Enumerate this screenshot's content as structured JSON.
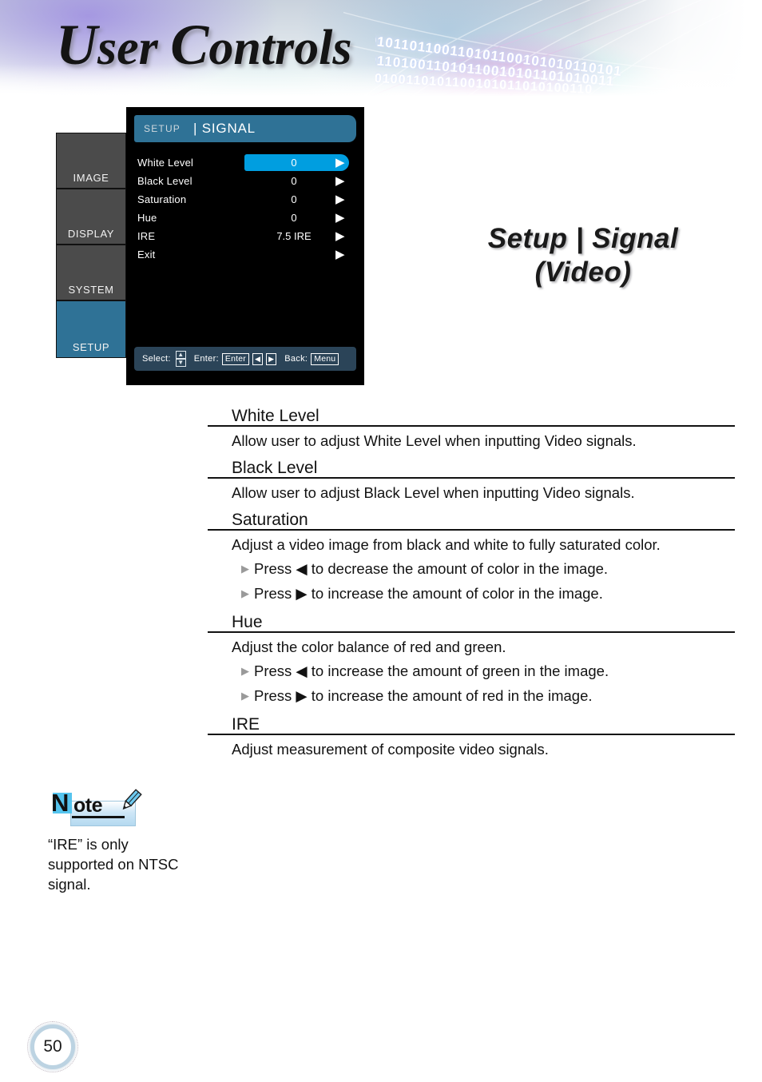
{
  "banner": {
    "title_part1": "U",
    "title_part2": "ser ",
    "title_part3": "C",
    "title_part4": "ontrols",
    "title_full": "User Controls",
    "binary_rows": [
      "1001",
      "0010",
      "1001",
      "10101101100110101100101010110101",
      "01011010011010110010101101010011",
      "10110100110101100101011010100110"
    ]
  },
  "osd": {
    "tabs": [
      {
        "label": "IMAGE",
        "selected": false
      },
      {
        "label": "DISPLAY",
        "selected": false
      },
      {
        "label": "SYSTEM",
        "selected": false
      },
      {
        "label": "SETUP",
        "selected": true
      }
    ],
    "header": {
      "category": "SETUP",
      "page": "| SIGNAL"
    },
    "rows": [
      {
        "label": "White Level",
        "value": "0",
        "arrow": "▶",
        "selected": true
      },
      {
        "label": "Black Level",
        "value": "0",
        "arrow": "▶",
        "selected": false
      },
      {
        "label": "Saturation",
        "value": "0",
        "arrow": "▶",
        "selected": false
      },
      {
        "label": "Hue",
        "value": "0",
        "arrow": "▶",
        "selected": false
      },
      {
        "label": "IRE",
        "value": "7.5 IRE",
        "arrow": "▶",
        "selected": false
      },
      {
        "label": "Exit",
        "value": "",
        "arrow": "▶",
        "selected": false
      }
    ],
    "footer": {
      "select_label": "Select:",
      "up_arrow": "▲",
      "down_arrow": "▼",
      "enter_label": "Enter:",
      "enter_key": "Enter",
      "left_key": "◀",
      "right_key": "▶",
      "back_label": "Back:",
      "menu_key": "Menu"
    },
    "colors": {
      "header_blue": "#2f7296",
      "selected_blue": "#009ee0",
      "tab_gray": "#4b4b4b",
      "footer_slate": "#2b4458",
      "panel_black": "#000000"
    }
  },
  "section_title": {
    "line1": "Setup | Signal",
    "line2": "(Video)"
  },
  "sections": [
    {
      "heading": "White Level",
      "paragraph": "Allow user to adjust White Level when inputting Video signals.",
      "bullets": []
    },
    {
      "heading": "Black Level",
      "paragraph": "Allow user to adjust Black Level when inputting Video signals.",
      "bullets": []
    },
    {
      "heading": "Saturation",
      "paragraph": "Adjust a video image from black and white to fully saturated color.",
      "bullets": [
        "Press ◀ to decrease the amount of color in the image.",
        "Press ▶ to increase the amount of color in the image."
      ]
    },
    {
      "heading": "Hue",
      "paragraph": "Adjust the color balance of red and green.",
      "bullets": [
        "Press ◀ to increase the amount of green in the image.",
        "Press ▶ to increase the amount of red in the image."
      ]
    },
    {
      "heading": "IRE",
      "paragraph": "Adjust measurement of composite video signals.",
      "bullets": []
    }
  ],
  "note": {
    "logo_n": "N",
    "logo_rest": "ote",
    "text": "“IRE” is only supported on NTSC signal."
  },
  "page_number": "50"
}
